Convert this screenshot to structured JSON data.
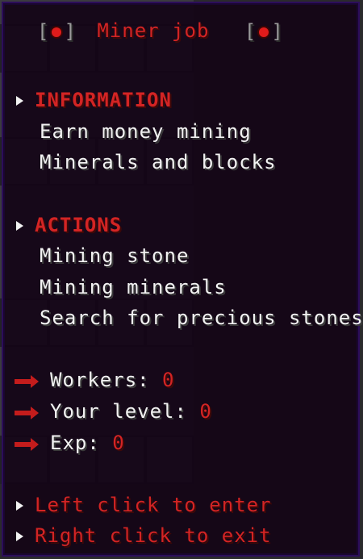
{
  "title": "Miner job",
  "sections": [
    {
      "heading": "INFORMATION",
      "items": [
        "Earn money mining",
        "Minerals and blocks"
      ]
    },
    {
      "heading": "ACTIONS",
      "items": [
        "Mining stone",
        "Mining minerals",
        "Search for precious stones"
      ]
    }
  ],
  "stats": [
    {
      "label": "Workers:",
      "value": "0"
    },
    {
      "label": "Your level:",
      "value": "0"
    },
    {
      "label": "Exp:",
      "value": "0"
    }
  ],
  "hints": [
    "Left click to enter",
    "Right click to exit"
  ],
  "icons": {
    "title": "red-orb-icon",
    "bullet": "triangle-bullet-icon",
    "stat": "red-arrow-icon"
  },
  "colors": {
    "tooltip_bg": "#140416",
    "accent_red": "#d32424",
    "text_white": "#f2f2f2",
    "border": "#2c0d5a"
  }
}
